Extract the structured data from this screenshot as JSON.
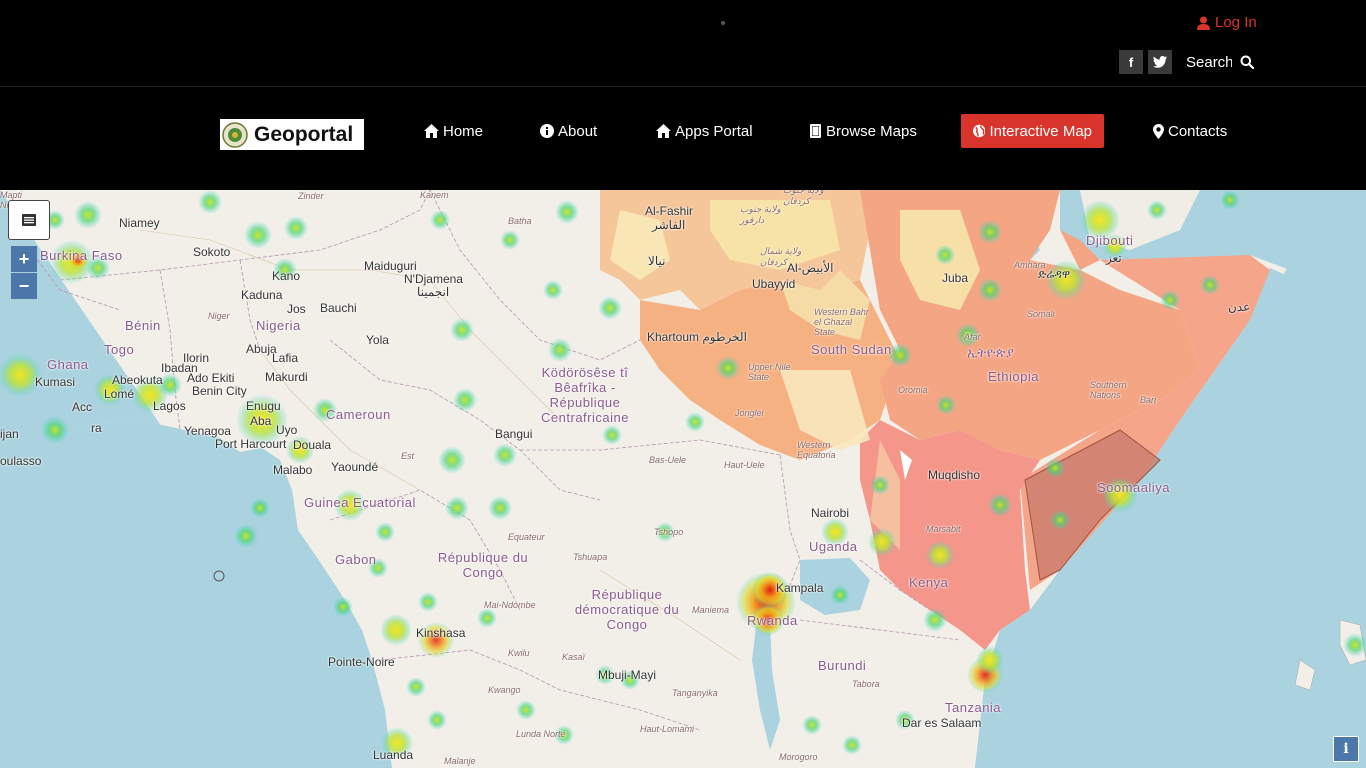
{
  "header": {
    "login_label": "Log In",
    "search_placeholder": "Search",
    "social": [
      {
        "name": "facebook",
        "glyph": "f"
      },
      {
        "name": "twitter",
        "glyph": "t"
      }
    ]
  },
  "brand": {
    "logo_text": "Geoportal"
  },
  "nav": [
    {
      "label": "Home",
      "icon": "home-icon"
    },
    {
      "label": "About",
      "icon": "info-circle-icon"
    },
    {
      "label": "Apps Portal",
      "icon": "home-icon"
    },
    {
      "label": "Browse Maps",
      "icon": "book-icon"
    },
    {
      "label": "Interactive Map",
      "icon": "globe-icon",
      "active": true
    },
    {
      "label": "Contacts",
      "icon": "map-marker-icon"
    }
  ],
  "colors": {
    "accent": "#d9342b",
    "ocean": "#aad3df",
    "land": "#f2efe9"
  },
  "map": {
    "controls": {
      "layers_icon": "layers-icon",
      "zoom_in": "+",
      "zoom_out": "−",
      "info": "i"
    },
    "labels": [
      {
        "text": "Niamey",
        "type": "city"
      },
      {
        "text": "Sokoto",
        "type": "city"
      },
      {
        "text": "Zinder",
        "type": "region"
      },
      {
        "text": "Kanem",
        "type": "region"
      },
      {
        "text": "Batha",
        "type": "region"
      },
      {
        "text": "Burkina Faso",
        "type": "country"
      },
      {
        "text": "Maiduguri",
        "type": "city"
      },
      {
        "text": "N'Djamena",
        "type": "city"
      },
      {
        "text": "انجمينا",
        "type": "city"
      },
      {
        "text": "Kano",
        "type": "city"
      },
      {
        "text": "Kaduna",
        "type": "city"
      },
      {
        "text": "Jos",
        "type": "city"
      },
      {
        "text": "Bauchi",
        "type": "city"
      },
      {
        "text": "Niger",
        "type": "region"
      },
      {
        "text": "Nigeria",
        "type": "country"
      },
      {
        "text": "Bénin",
        "type": "country"
      },
      {
        "text": "Togo",
        "type": "country"
      },
      {
        "text": "Ghana",
        "type": "country"
      },
      {
        "text": "Kumasi",
        "type": "city"
      },
      {
        "text": "Abuja",
        "type": "city"
      },
      {
        "text": "Lafia",
        "type": "city"
      },
      {
        "text": "Yola",
        "type": "city"
      },
      {
        "text": "Ilorin",
        "type": "city"
      },
      {
        "text": "Ibadan",
        "type": "city"
      },
      {
        "text": "Abeokuta",
        "type": "city"
      },
      {
        "text": "Ado Ekiti",
        "type": "city"
      },
      {
        "text": "Makurdi",
        "type": "city"
      },
      {
        "text": "Lomé",
        "type": "city"
      },
      {
        "text": "Benin City",
        "type": "city"
      },
      {
        "text": "Lagos",
        "type": "city"
      },
      {
        "text": "Enugu",
        "type": "city"
      },
      {
        "text": "Aba",
        "type": "city"
      },
      {
        "text": "Uyo",
        "type": "city"
      },
      {
        "text": "Acc",
        "type": "city"
      },
      {
        "text": "ra",
        "type": "city"
      },
      {
        "text": "ijan",
        "type": "city"
      },
      {
        "text": "oulasso",
        "type": "city"
      },
      {
        "text": "Yenagoa",
        "type": "city"
      },
      {
        "text": "Port Harcourt",
        "type": "city"
      },
      {
        "text": "Cameroun",
        "type": "country"
      },
      {
        "text": "Douala",
        "type": "city"
      },
      {
        "text": "Malabo",
        "type": "city"
      },
      {
        "text": "Yaoundé",
        "type": "city"
      },
      {
        "text": "Est",
        "type": "region"
      },
      {
        "text": "Guinea Ecuatorial",
        "type": "country"
      },
      {
        "text": "Gabon",
        "type": "country"
      },
      {
        "text": "République du Congo",
        "type": "country"
      },
      {
        "text": "Pointe-Noire",
        "type": "city"
      },
      {
        "text": "Kinshasa",
        "type": "city"
      },
      {
        "text": "Luanda",
        "type": "city"
      },
      {
        "text": "Malanje",
        "type": "region"
      },
      {
        "text": "Kwango",
        "type": "region"
      },
      {
        "text": "Kwilu",
        "type": "region"
      },
      {
        "text": "Mai-Ndombe",
        "type": "region"
      },
      {
        "text": "Kasaï",
        "type": "region"
      },
      {
        "text": "Lunda Norte",
        "type": "region"
      },
      {
        "text": "Mbuji-Mayi",
        "type": "city"
      },
      {
        "text": "Tanganyika",
        "type": "region"
      },
      {
        "text": "Haut-Lomami",
        "type": "region"
      },
      {
        "text": "République démocratique du Congo",
        "type": "country"
      },
      {
        "text": "Maniema",
        "type": "region"
      },
      {
        "text": "Tshuapa",
        "type": "region"
      },
      {
        "text": "Equateur",
        "type": "region"
      },
      {
        "text": "Tshopo",
        "type": "region"
      },
      {
        "text": "Bas-Uele",
        "type": "region"
      },
      {
        "text": "Haut-Uele",
        "type": "region"
      },
      {
        "text": "Bangui",
        "type": "city"
      },
      {
        "text": "Ködörösêse tî Bêafrîka - République Centrafricaine",
        "type": "country"
      },
      {
        "text": "Al-Fashir",
        "type": "city"
      },
      {
        "text": "الفاشر",
        "type": "city"
      },
      {
        "text": "نيالا",
        "type": "city"
      },
      {
        "text": "ولاية جنوب دارفور",
        "type": "region"
      },
      {
        "text": "ولاية شمال كردفان",
        "type": "region"
      },
      {
        "text": "Al-الأبيض",
        "type": "city"
      },
      {
        "text": "Ubayyid",
        "type": "city"
      },
      {
        "text": "ولاية جنوب كردفان",
        "type": "region"
      },
      {
        "text": "Khartoum الخرطوم",
        "type": "city"
      },
      {
        "text": "Western Bahr el Ghazal State",
        "type": "region"
      },
      {
        "text": "Upper Nile State",
        "type": "region"
      },
      {
        "text": "South Sudan",
        "type": "country"
      },
      {
        "text": "Jonglei",
        "type": "region"
      },
      {
        "text": "Western Equatoria",
        "type": "region"
      },
      {
        "text": "Juba",
        "type": "city"
      },
      {
        "text": "Amhara",
        "type": "region"
      },
      {
        "text": "Afar",
        "type": "region"
      },
      {
        "text": "ኢትዮጵያ",
        "type": "country"
      },
      {
        "text": "Ethiopia",
        "type": "country"
      },
      {
        "text": "Oromia",
        "type": "region"
      },
      {
        "text": "Southern Nations",
        "type": "region"
      },
      {
        "text": "Somali",
        "type": "region"
      },
      {
        "text": "ድሬዳዋ",
        "type": "city"
      },
      {
        "text": "Djibouti",
        "type": "country"
      },
      {
        "text": "تعز",
        "type": "city"
      },
      {
        "text": "عدن",
        "type": "city"
      },
      {
        "text": "Bari",
        "type": "region"
      },
      {
        "text": "Soomaaliya",
        "type": "country"
      },
      {
        "text": "Muqdisho",
        "type": "city"
      },
      {
        "text": "Marsabit",
        "type": "region"
      },
      {
        "text": "Kenya",
        "type": "country"
      },
      {
        "text": "Nairobi",
        "type": "city"
      },
      {
        "text": "Uganda",
        "type": "country"
      },
      {
        "text": "Kampala",
        "type": "city"
      },
      {
        "text": "Rwanda",
        "type": "country"
      },
      {
        "text": "Burundi",
        "type": "country"
      },
      {
        "text": "Tabora",
        "type": "region"
      },
      {
        "text": "Tanzania",
        "type": "country"
      },
      {
        "text": "Dar es Salaam",
        "type": "city"
      },
      {
        "text": "Morogoro",
        "type": "region"
      },
      {
        "text": "Northern",
        "type": "region"
      },
      {
        "text": "Mapti",
        "type": "region"
      }
    ]
  }
}
